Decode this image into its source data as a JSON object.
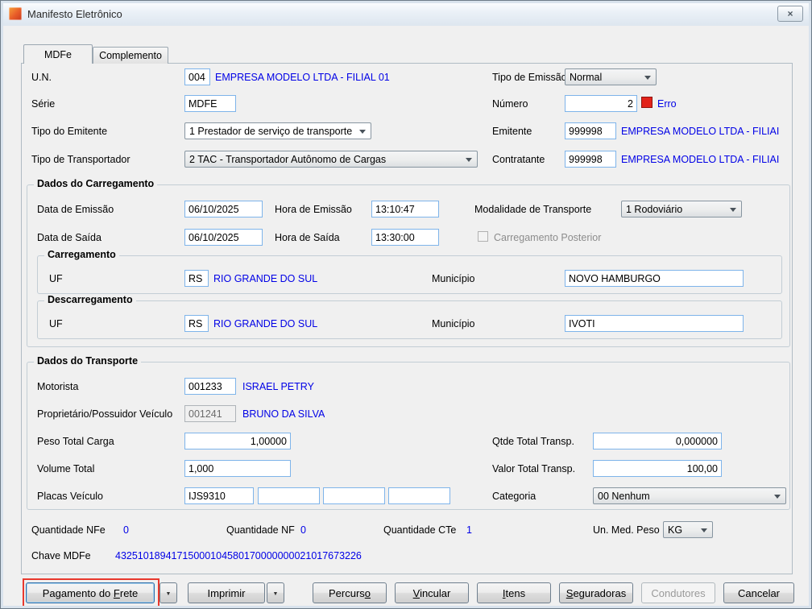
{
  "window": {
    "title": "Manifesto Eletrônico",
    "close_glyph": "×"
  },
  "tabs": [
    {
      "label": "MDFe"
    },
    {
      "label": "Complemento"
    }
  ],
  "header": {
    "un_label": "U.N.",
    "un_code": "004",
    "un_name": "EMPRESA MODELO LTDA - FILIAL 01",
    "tipo_emissao_label": "Tipo de Emissão",
    "tipo_emissao_value": "Normal",
    "serie_label": "Série",
    "serie_value": "MDFE",
    "numero_label": "Número",
    "numero_value": "2",
    "erro_label": "Erro",
    "tipo_emitente_label": "Tipo do Emitente",
    "tipo_emitente_value": "1 Prestador de serviço de transporte",
    "emitente_label": "Emitente",
    "emitente_code": "999998",
    "emitente_name": "EMPRESA MODELO LTDA - FILIAI",
    "tipo_transportador_label": "Tipo de Transportador",
    "tipo_transportador_value": "2 TAC - Transportador Autônomo de Cargas",
    "contratante_label": "Contratante",
    "contratante_code": "999998",
    "contratante_name": "EMPRESA MODELO LTDA - FILIAI"
  },
  "carregamento": {
    "title": "Dados do Carregamento",
    "data_emissao_label": "Data de Emissão",
    "data_emissao_value": "06/10/2025",
    "hora_emissao_label": "Hora de Emissão",
    "hora_emissao_value": "13:10:47",
    "modalidade_label": "Modalidade de Transporte",
    "modalidade_value": "1 Rodoviário",
    "data_saida_label": "Data de Saída",
    "data_saida_value": "06/10/2025",
    "hora_saida_label": "Hora de Saída",
    "hora_saida_value": "13:30:00",
    "posterior_label": "Carregamento Posterior",
    "origem": {
      "title": "Carregamento",
      "uf_label": "UF",
      "uf_value": "RS",
      "uf_name": "RIO GRANDE DO SUL",
      "municipio_label": "Município",
      "municipio_value": "NOVO HAMBURGO"
    },
    "destino": {
      "title": "Descarregamento",
      "uf_label": "UF",
      "uf_value": "RS",
      "uf_name": "RIO GRANDE DO SUL",
      "municipio_label": "Município",
      "municipio_value": "IVOTI"
    }
  },
  "transporte": {
    "title": "Dados do Transporte",
    "motorista_label": "Motorista",
    "motorista_code": "001233",
    "motorista_name": "ISRAEL PETRY",
    "proprietario_label": "Proprietário/Possuidor Veículo",
    "proprietario_code": "001241",
    "proprietario_name": "BRUNO DA SILVA",
    "peso_label": "Peso Total Carga",
    "peso_value": "1,00000",
    "qtde_label": "Qtde Total Transp.",
    "qtde_value": "0,000000",
    "volume_label": "Volume Total",
    "volume_value": "1,000",
    "valor_label": "Valor Total Transp.",
    "valor_value": "100,00",
    "placas_label": "Placas Veículo",
    "placa1": "IJS9310",
    "placa2": "",
    "placa3": "",
    "placa4": "",
    "categoria_label": "Categoria",
    "categoria_value": "00 Nenhum"
  },
  "summary": {
    "nfe_label": "Quantidade NFe",
    "nfe_value": "0",
    "nf_label": "Quantidade NF",
    "nf_value": "0",
    "cte_label": "Quantidade CTe",
    "cte_value": "1",
    "unmed_label": "Un. Med. Peso",
    "unmed_value": "KG",
    "chave_label": "Chave MDFe",
    "chave_value": "43251018941715000104580170000000021017673226"
  },
  "buttons": {
    "pagamento": {
      "pre": "Pagamento do ",
      "mn": "F",
      "post": "rete"
    },
    "imprimir": {
      "pre": "Imprimir",
      "mn": "",
      "post": ""
    },
    "percurso": {
      "pre": "Percurs",
      "mn": "o",
      "post": ""
    },
    "vincular": {
      "pre": "",
      "mn": "V",
      "post": "incular"
    },
    "itens": {
      "pre": "",
      "mn": "I",
      "post": "tens"
    },
    "seguradoras": {
      "pre": "",
      "mn": "S",
      "post": "eguradoras"
    },
    "condutores": {
      "pre": "Condutores",
      "mn": "",
      "post": ""
    },
    "cancelar": {
      "pre": "Cancelar",
      "mn": "",
      "post": ""
    },
    "dropdown_glyph": "▼"
  },
  "colors": {
    "value_blue": "#0000e6",
    "error_red": "#e2231a",
    "highlight_red": "#e8392e",
    "field_border_blue": "#7eb4ea"
  }
}
